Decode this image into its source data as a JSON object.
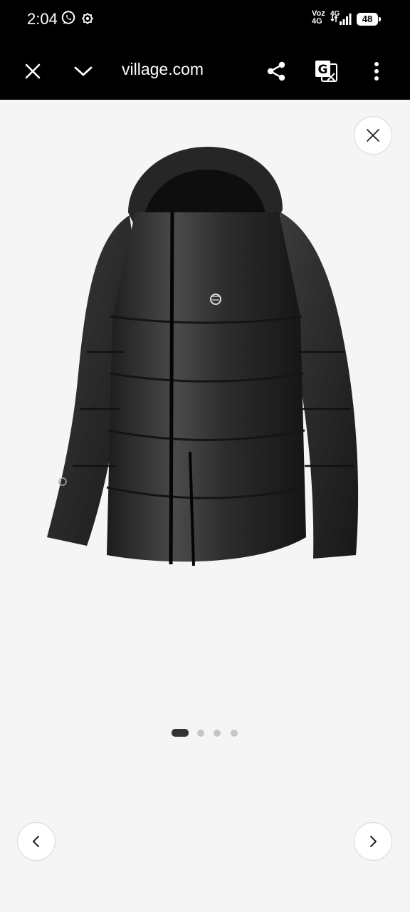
{
  "status_bar": {
    "time": "2:04",
    "network_label": "Voz",
    "network_type_top": "4G",
    "network_type_bottom": "4G",
    "battery": "48"
  },
  "toolbar": {
    "url": "village.com"
  },
  "gallery": {
    "image_count": 4,
    "active_index": 0
  },
  "colors": {
    "bar_background": "#000000",
    "page_background": "#f5f5f5",
    "active_dot": "#333333",
    "inactive_dot": "#c6c6c6"
  }
}
